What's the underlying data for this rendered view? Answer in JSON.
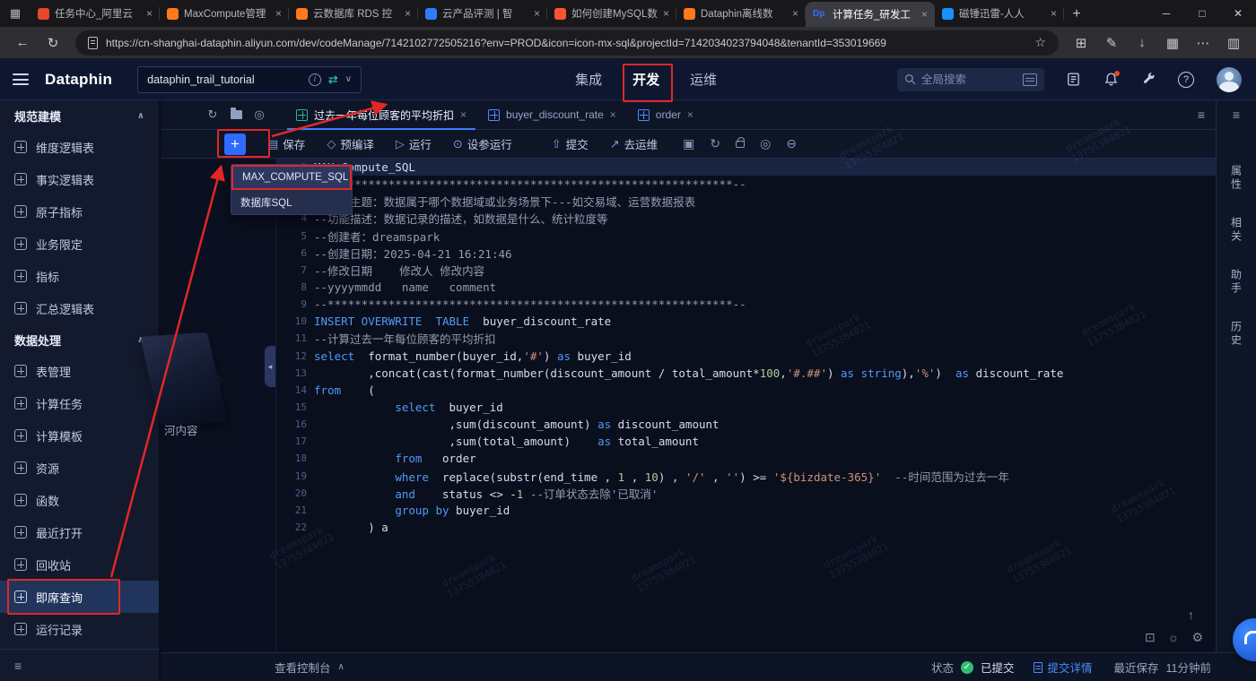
{
  "browser": {
    "tabs": [
      {
        "title": "任务中心_阿里云",
        "fav_color": "#e8452c"
      },
      {
        "title": "MaxCompute管理",
        "fav_color": "#ff7a1a"
      },
      {
        "title": "云数据库 RDS 控",
        "fav_color": "#ff7a1a"
      },
      {
        "title": "云产品评测 | 智",
        "fav_color": "#2f7cf6"
      },
      {
        "title": "如何创建MySQL数",
        "fav_color": "#fc5531"
      },
      {
        "title": "Dataphin离线数",
        "fav_color": "#ff7a1a"
      },
      {
        "title": "计算任务_研发工",
        "fav_color": "#3370ff",
        "fav_text": "Dp",
        "active": true
      },
      {
        "title": "磁锤迅雷-人人",
        "fav_color": "#1890ff"
      }
    ],
    "url": "https://cn-shanghai-dataphin.aliyun.com/dev/codeManage/7142102772505216?env=PROD&icon=icon-mx-sql&projectId=7142034023794048&tenantId=353019669"
  },
  "header": {
    "logo": "Dataphin",
    "project": "dataphin_trail_tutorial",
    "nav": [
      {
        "label": "集成"
      },
      {
        "label": "开发",
        "active": true
      },
      {
        "label": "运维"
      }
    ],
    "search_placeholder": "全局搜索"
  },
  "sidebar": {
    "sections": [
      {
        "title": "规范建模",
        "items": [
          {
            "label": "维度逻辑表",
            "icon": "dimension-logic-table-icon"
          },
          {
            "label": "事实逻辑表",
            "icon": "fact-logic-table-icon"
          },
          {
            "label": "原子指标",
            "icon": "atomic-metric-icon"
          },
          {
            "label": "业务限定",
            "icon": "business-filter-icon"
          },
          {
            "label": "指标",
            "icon": "metric-icon"
          },
          {
            "label": "汇总逻辑表",
            "icon": "aggregate-logic-table-icon"
          }
        ]
      },
      {
        "title": "数据处理",
        "items": [
          {
            "label": "表管理",
            "icon": "table-management-icon"
          },
          {
            "label": "计算任务",
            "icon": "compute-task-icon"
          },
          {
            "label": "计算模板",
            "icon": "compute-template-icon"
          },
          {
            "label": "资源",
            "icon": "resource-icon"
          },
          {
            "label": "函数",
            "icon": "function-icon"
          },
          {
            "label": "最近打开",
            "icon": "recently-opened-icon"
          },
          {
            "label": "回收站",
            "icon": "recycle-bin-icon"
          },
          {
            "label": "即席查询",
            "icon": "adhoc-query-icon",
            "selected": true
          },
          {
            "label": "运行记录",
            "icon": "run-history-icon"
          }
        ]
      }
    ]
  },
  "editor": {
    "tabs": [
      {
        "label": "过去一年每位顾客的平均折扣",
        "active": true,
        "icon_color": "#2fb39b"
      },
      {
        "label": "buyer_discount_rate",
        "icon_color": "#4c8dff"
      },
      {
        "label": "order",
        "icon_color": "#4c8dff"
      }
    ],
    "toolbar": {
      "buttons": [
        {
          "label": "保存"
        },
        {
          "label": "预编译"
        },
        {
          "label": "运行"
        },
        {
          "label": "设参运行"
        },
        {
          "label": "提交"
        },
        {
          "label": "去运维"
        }
      ]
    },
    "dropdown": {
      "items": [
        {
          "label": "MAX_COMPUTE_SQL",
          "annotated": true
        },
        {
          "label": "数据库SQL"
        }
      ]
    },
    "watermark": {
      "name": "dreamspark",
      "number": "13755384021"
    },
    "code": {
      "lines": [
        [
          [
            "p",
            "MAX_Compute_SQL"
          ]
        ],
        [
          [
            "c",
            "--************************************************************--"
          ]
        ],
        [
          [
            "c",
            "--代码主题：数据属于哪个数据域或业务场景下---如交易域、运营数据报表"
          ]
        ],
        [
          [
            "c",
            "--功能描述：数据记录的描述，如数据是什么、统计粒度等"
          ]
        ],
        [
          [
            "c",
            "--创建者：dreamspark"
          ]
        ],
        [
          [
            "c",
            "--创建日期：2025-04-21 16:21:46"
          ]
        ],
        [
          [
            "c",
            "--修改日期    修改人 修改内容"
          ]
        ],
        [
          [
            "c",
            "--yyyymmdd   name   comment"
          ]
        ],
        [
          [
            "c",
            "--************************************************************--"
          ]
        ],
        [
          [
            "k",
            "INSERT OVERWRITE"
          ],
          [
            "p",
            "  "
          ],
          [
            "k",
            "TABLE"
          ],
          [
            "p",
            "  buyer_discount_rate"
          ]
        ],
        [
          [
            "c",
            "--计算过去一年每位顾客的平均折扣"
          ]
        ],
        [
          [
            "k",
            "select"
          ],
          [
            "p",
            "  format_number(buyer_id,"
          ],
          [
            "s",
            "'#'"
          ],
          [
            "p",
            ") "
          ],
          [
            "k",
            "as"
          ],
          [
            "p",
            " buyer_id"
          ]
        ],
        [
          [
            "p",
            "        ,concat(cast(format_number(discount_amount / total_amount*"
          ],
          [
            "n",
            "100"
          ],
          [
            "p",
            ","
          ],
          [
            "s",
            "'#.##'"
          ],
          [
            "p",
            ") "
          ],
          [
            "k",
            "as"
          ],
          [
            "p",
            " "
          ],
          [
            "k",
            "string"
          ],
          [
            "p",
            "),"
          ],
          [
            "s",
            "'%'"
          ],
          [
            "p",
            ")  "
          ],
          [
            "k",
            "as"
          ],
          [
            "p",
            " discount_rate"
          ]
        ],
        [
          [
            "k",
            "from"
          ],
          [
            "p",
            "    ("
          ]
        ],
        [
          [
            "p",
            "            "
          ],
          [
            "k",
            "select"
          ],
          [
            "p",
            "  buyer_id"
          ]
        ],
        [
          [
            "p",
            "                    ,sum(discount_amount) "
          ],
          [
            "k",
            "as"
          ],
          [
            "p",
            " discount_amount"
          ]
        ],
        [
          [
            "p",
            "                    ,sum(total_amount)    "
          ],
          [
            "k",
            "as"
          ],
          [
            "p",
            " total_amount"
          ]
        ],
        [
          [
            "p",
            "            "
          ],
          [
            "k",
            "from"
          ],
          [
            "p",
            "   order"
          ]
        ],
        [
          [
            "p",
            "            "
          ],
          [
            "k",
            "where"
          ],
          [
            "p",
            "  replace(substr(end_time , "
          ],
          [
            "n",
            "1"
          ],
          [
            "p",
            " , "
          ],
          [
            "n",
            "10"
          ],
          [
            "p",
            ") , "
          ],
          [
            "s",
            "'/'"
          ],
          [
            "p",
            " , "
          ],
          [
            "s",
            "''"
          ],
          [
            "p",
            ") >= "
          ],
          [
            "s",
            "'${bizdate-365}'"
          ],
          [
            "p",
            "  "
          ],
          [
            "c",
            "--时间范围为过去一年"
          ]
        ],
        [
          [
            "p",
            "            "
          ],
          [
            "k",
            "and"
          ],
          [
            "p",
            "    status <> -"
          ],
          [
            "n",
            "1"
          ],
          [
            "p",
            " "
          ],
          [
            "c",
            "--订单状态去除'已取消'"
          ]
        ],
        [
          [
            "p",
            "            "
          ],
          [
            "k",
            "group by"
          ],
          [
            "p",
            " buyer_id"
          ]
        ],
        [
          [
            "p",
            "        ) a"
          ]
        ]
      ]
    }
  },
  "right_rail": {
    "tabs": [
      {
        "label": "属性"
      },
      {
        "label": "相关"
      },
      {
        "label": "助手"
      },
      {
        "label": "历史"
      }
    ]
  },
  "status_bar": {
    "console_label": "查看控制台",
    "status_label": "状态",
    "status_value": "已提交",
    "detail_label": "提交详情",
    "saved_label": "最近保存",
    "saved_time": "11分钟前"
  },
  "artifact_text": "河内容",
  "colors": {
    "accent": "#3370ff",
    "annotation": "#e12727",
    "keyword": "#519af5",
    "string": "#ce9178",
    "comment": "#939db2",
    "number": "#a9cf95",
    "status_green": "#2fbf71"
  }
}
